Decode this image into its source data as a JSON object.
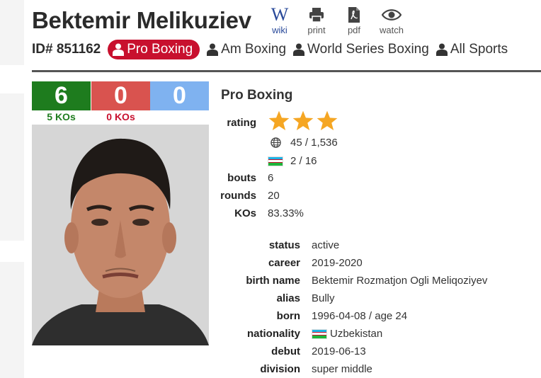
{
  "boxer": {
    "name": "Bektemir Melikuziev",
    "id_label": "ID# 851162"
  },
  "toolbar": {
    "wiki": "wiki",
    "print": "print",
    "pdf": "pdf",
    "watch": "watch"
  },
  "sports": [
    {
      "label": "Pro Boxing",
      "active": true
    },
    {
      "label": "Am Boxing",
      "active": false
    },
    {
      "label": "World Series Boxing",
      "active": false
    },
    {
      "label": "All Sports",
      "active": false
    }
  ],
  "record": {
    "wins": "6",
    "losses": "0",
    "draws": "0",
    "wins_ko": "5 KOs",
    "losses_ko": "0 KOs"
  },
  "profile": {
    "section_title": "Pro Boxing",
    "rating_label": "rating",
    "rating_stars": 3,
    "world_rank": "45 / 1,536",
    "country_rank": "2 / 16",
    "bouts_label": "bouts",
    "bouts": "6",
    "rounds_label": "rounds",
    "rounds": "20",
    "kos_label": "KOs",
    "kos": "83.33%"
  },
  "details": {
    "status_label": "status",
    "status": "active",
    "career_label": "career",
    "career": "2019-2020",
    "birth_name_label": "birth name",
    "birth_name": "Bektemir Rozmatjon Ogli Meliqoziyev",
    "alias_label": "alias",
    "alias": "Bully",
    "born_label": "born",
    "born": "1996-04-08 / age 24",
    "nationality_label": "nationality",
    "nationality": "Uzbekistan",
    "debut_label": "debut",
    "debut": "2019-06-13",
    "division_label": "division",
    "division": "super middle"
  },
  "colors": {
    "win": "#1e7c1e",
    "loss": "#d9534f",
    "draw": "#7fb2f0",
    "active_tab": "#c8102e",
    "star": "#f5a623"
  }
}
